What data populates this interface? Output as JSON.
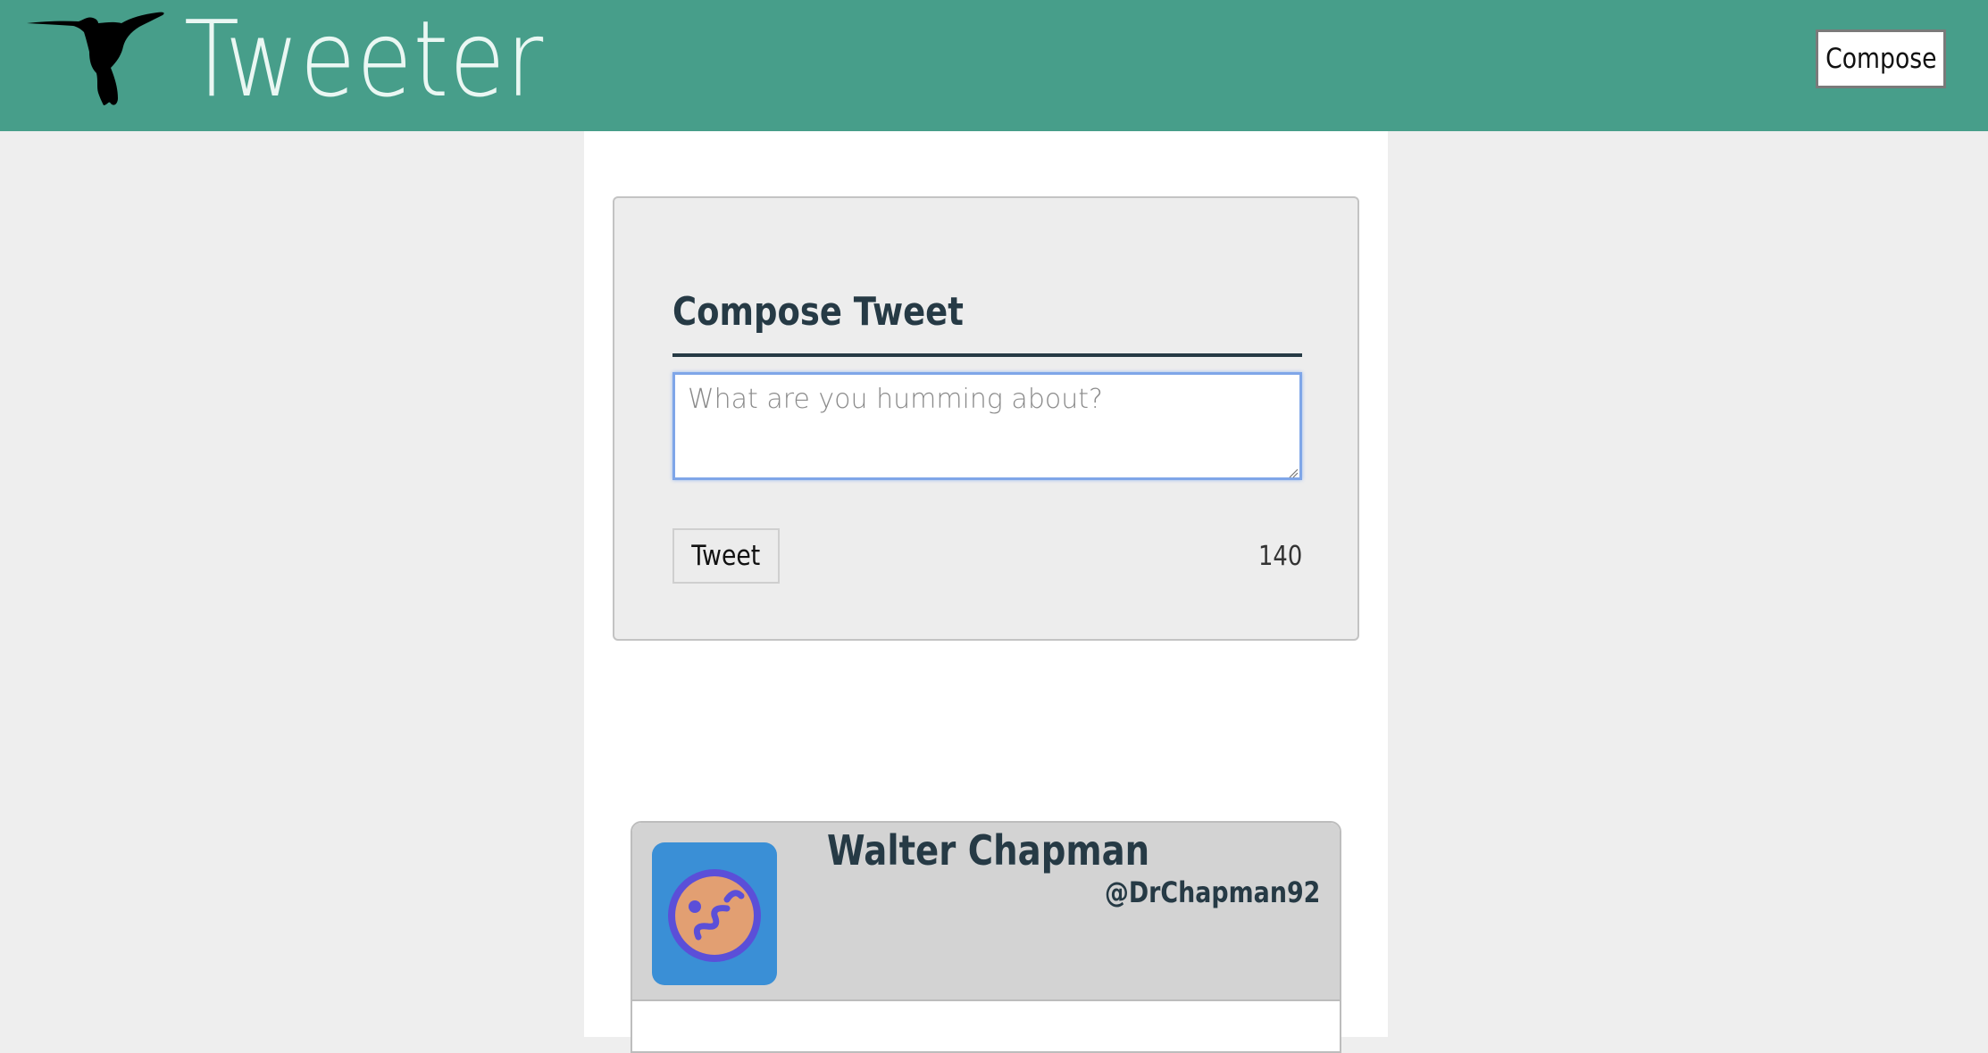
{
  "header": {
    "brand_title": "Tweeter",
    "logo_icon": "hummingbird-icon",
    "compose_button_label": "Compose",
    "background_color": "#479e8a"
  },
  "compose": {
    "title": "Compose Tweet",
    "placeholder": "What are you humming about?",
    "value": "",
    "tweet_button_label": "Tweet",
    "char_count": "140"
  },
  "tweets": [
    {
      "name": "Walter Chapman",
      "handle": "@DrChapman92",
      "avatar_icon": "emoji-avatar-icon"
    }
  ]
}
